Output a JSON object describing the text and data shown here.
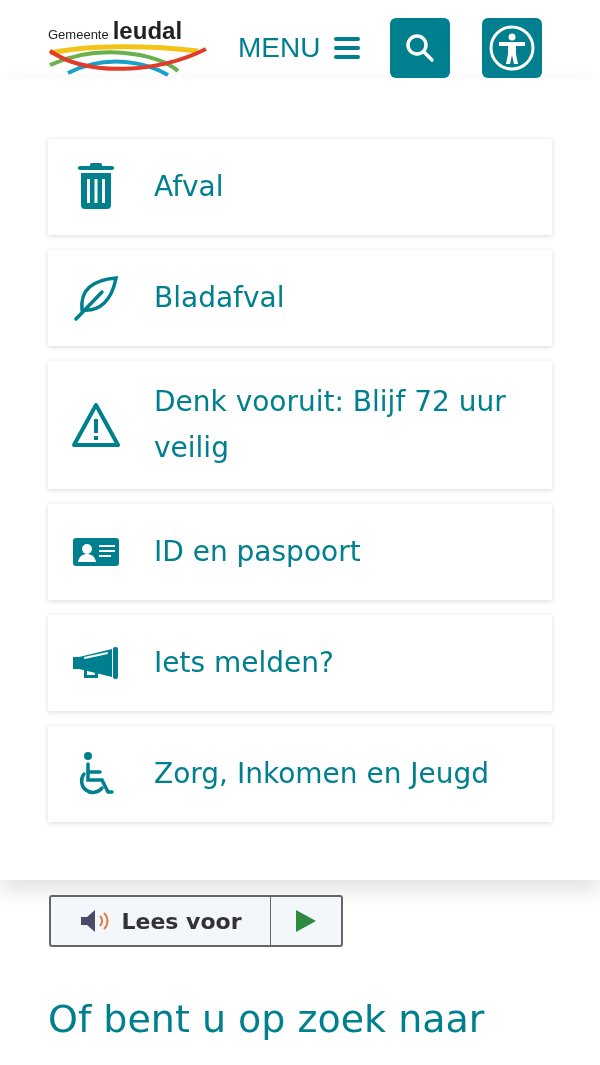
{
  "header": {
    "logo": {
      "prefix": "Gemeente",
      "name": "leudal"
    },
    "menu_label": "MENU"
  },
  "links": [
    {
      "kind": "trash",
      "label": "Afval"
    },
    {
      "kind": "leaf",
      "label": "Bladafval"
    },
    {
      "kind": "warning",
      "label": "Denk vooruit: Blijf 72 uur veilig"
    },
    {
      "kind": "id-card",
      "label": "ID en paspoort"
    },
    {
      "kind": "megaphone",
      "label": "Iets melden?"
    },
    {
      "kind": "wheelchair",
      "label": "Zorg, Inkomen en Jeugd"
    }
  ],
  "read_aloud": {
    "label": "Lees voor"
  },
  "heading": "Of bent u op zoek naar"
}
